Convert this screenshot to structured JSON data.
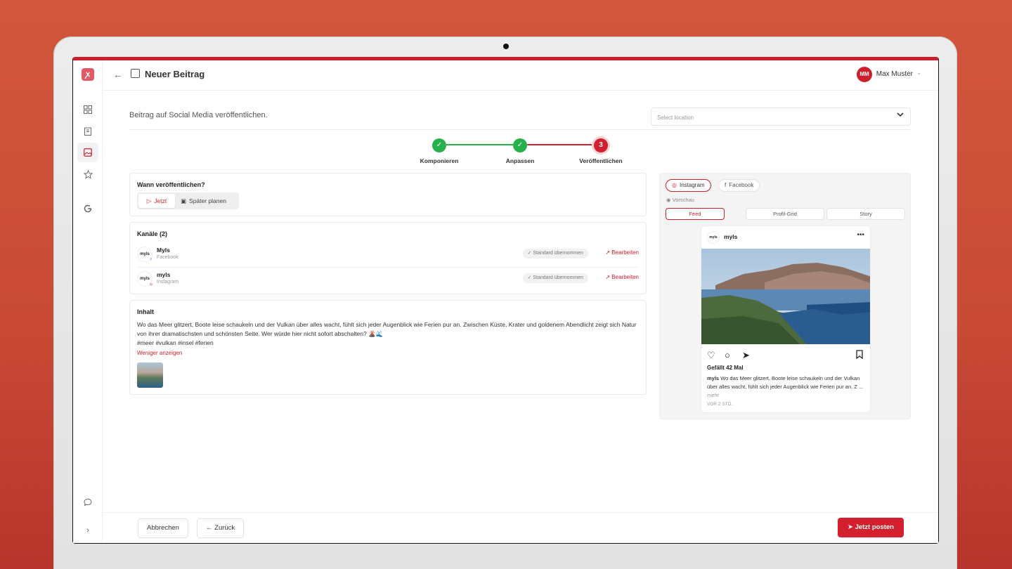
{
  "app": {
    "title": "Neuer Beitrag",
    "logo_glyph": "ꭗ",
    "user": {
      "initials": "MM",
      "name": "Max Muster"
    }
  },
  "sidebar": {
    "icons": [
      "grid-icon",
      "building-icon",
      "image-icon",
      "star-icon",
      "google-icon",
      "chat-icon",
      "chevron-right-icon"
    ]
  },
  "page": {
    "subtitle": "Beitrag auf Social Media veröffentlichen.",
    "location_placeholder": "Select location"
  },
  "stepper": {
    "steps": [
      {
        "label": "Komponieren",
        "state": "done"
      },
      {
        "label": "Anpassen",
        "state": "done"
      },
      {
        "label": "Veröffentlichen",
        "state": "current",
        "number": "3"
      }
    ],
    "colors": {
      "done": "#27b04c",
      "current": "#d4202e"
    }
  },
  "schedule": {
    "title": "Wann veröffentlichen?",
    "now_label": "Jetzt",
    "later_label": "Später planen"
  },
  "channels": {
    "title": "Kanäle (2)",
    "items": [
      {
        "avatar": "myls",
        "name": "Myls",
        "platform": "Facebook",
        "standard": "✓ Standard übernommen",
        "edit": "Bearbeiten"
      },
      {
        "avatar": "myls",
        "name": "myls",
        "platform": "Instagram",
        "standard": "✓ Standard übernommen",
        "edit": "Bearbeiten"
      }
    ]
  },
  "content": {
    "title": "Inhalt",
    "text": "Wo das Meer glitzert, Boote leise schaukeln und der Vulkan über alles wacht, fühlt sich jeder Augenblick wie Ferien pur an. Zwischen Küste, Krater und goldenem Abendlicht zeigt sich Natur von ihrer dramatischsten und schönsten Seite. Wer würde hier nicht sofort abschalten? 🌋🌊",
    "hashtags": "#meer #vulkan #insel #ferien",
    "less_link": "Weniger anzeigen"
  },
  "preview": {
    "platform_tabs": [
      "Instagram",
      "Facebook"
    ],
    "vorschau_label": "Vorschau",
    "view_tabs": [
      "Feed",
      "Profil-Grid",
      "Story"
    ],
    "post": {
      "avatar": "myls",
      "user": "myls",
      "likes": "Gefällt 42 Mal",
      "caption_user": "myls",
      "caption": "Wo das Meer glitzert, Boote leise schaukeln und der Vulkan über alles wacht, fühlt sich jeder Augenblick wie Ferien pur an. Z ...",
      "more": "mehr",
      "time": "VOR 2 STD."
    }
  },
  "footer": {
    "cancel": "Abbrechen",
    "back": "← Zurück",
    "post_now": "Jetzt posten"
  }
}
